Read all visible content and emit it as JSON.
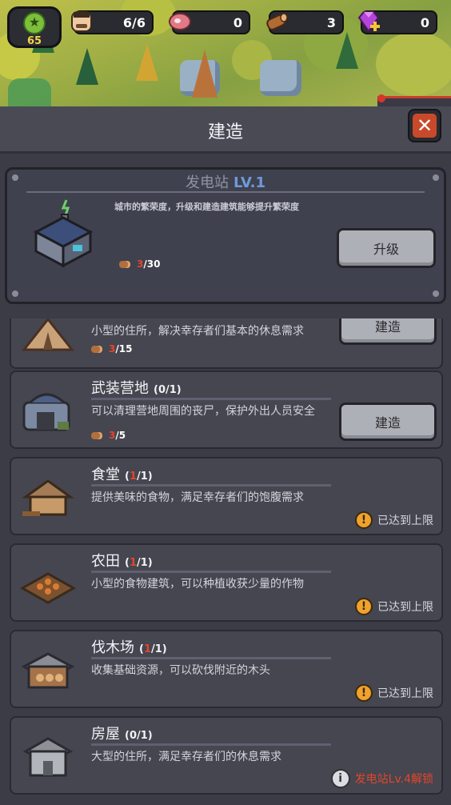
{
  "hud": {
    "level": "65",
    "survivors": "6/6",
    "meat": "0",
    "wood": "3",
    "gems": "0"
  },
  "panel": {
    "title": "建造",
    "close_label": "✕"
  },
  "station": {
    "name": "发电站",
    "level": "LV.1",
    "desc": "城市的繁荣度，升级和建造建筑能够提升繁荣度",
    "cost_have": "3",
    "cost_need": "/30",
    "upgrade_label": "升级"
  },
  "buildings": [
    {
      "name": "",
      "count_current": "",
      "count_max": "",
      "desc": "小型的住所，解决幸存者们基本的休息需求",
      "cost_have": "3",
      "cost_need": "/15",
      "build_label": "建造"
    },
    {
      "name": "武装营地",
      "count_open": "(",
      "count_current": "0",
      "count_max": "/1)",
      "desc": "可以清理营地周围的丧尸，保护外出人员安全",
      "cost_have": "3",
      "cost_need": "/5",
      "build_label": "建造"
    },
    {
      "name": "食堂",
      "count_open": "(",
      "count_current": "1",
      "count_max": "/1)",
      "desc": "提供美味的食物，满足幸存者们的饱腹需求",
      "status": "已达到上限"
    },
    {
      "name": "农田",
      "count_open": "(",
      "count_current": "1",
      "count_max": "/1)",
      "desc": "小型的食物建筑，可以种植收获少量的作物",
      "status": "已达到上限"
    },
    {
      "name": "伐木场",
      "count_open": "(",
      "count_current": "1",
      "count_max": "/1)",
      "desc": "收集基础资源，可以砍伐附近的木头",
      "status": "已达到上限"
    },
    {
      "name": "房屋",
      "count_open": "(",
      "count_current": "0",
      "count_max": "/1)",
      "desc": "大型的住所，满足幸存者们的休息需求",
      "lock_text": "发电站Lv.4解锁"
    }
  ],
  "icons": {
    "warn": "!",
    "info": "i",
    "star": "★"
  },
  "colors": {
    "accent_red": "#e3452c",
    "level_blue": "#6f9ad8",
    "warn_orange": "#f0a22d"
  }
}
